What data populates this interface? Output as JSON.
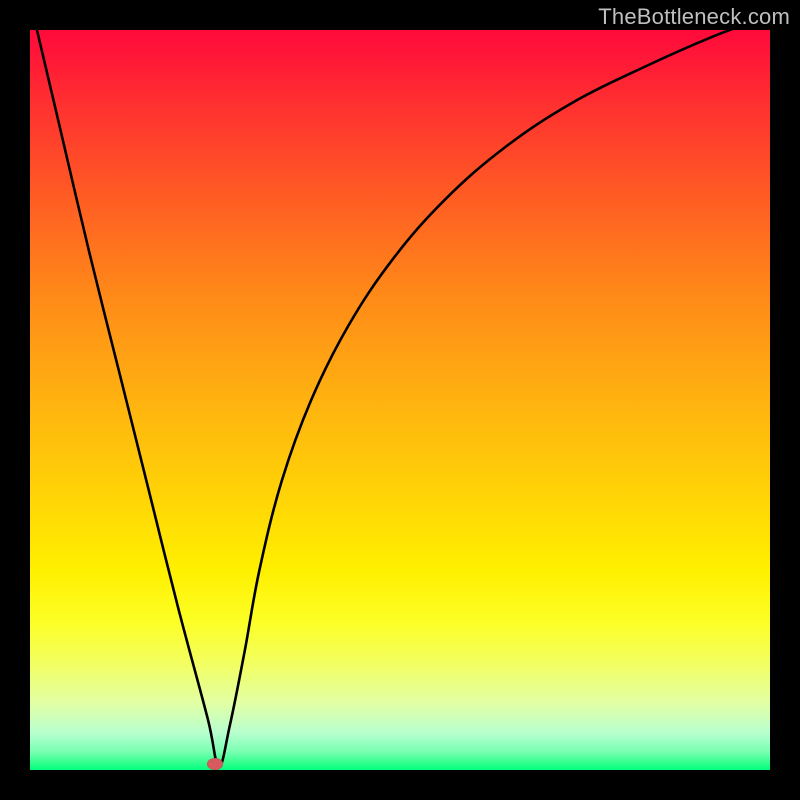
{
  "watermark": "TheBottleneck.com",
  "frame": {
    "outer_w": 800,
    "outer_h": 800,
    "border": 30
  },
  "chart_data": {
    "type": "line",
    "title": "",
    "xlabel": "",
    "ylabel": "",
    "xlim": [
      0,
      100
    ],
    "ylim": [
      0,
      100
    ],
    "grid": false,
    "legend": false,
    "series": [
      {
        "name": "bottleneck-curve",
        "x": [
          0,
          4,
          8,
          12,
          16,
          20,
          24,
          25.5,
          27,
          29,
          31,
          34,
          38,
          43,
          49,
          56,
          64,
          73,
          83,
          92,
          100
        ],
        "y": [
          104,
          87,
          70,
          54,
          38,
          22,
          7,
          0.5,
          6,
          16,
          27,
          39,
          50,
          60,
          69,
          77,
          84,
          90,
          95,
          99,
          102
        ]
      }
    ],
    "markers": [
      {
        "name": "highlight-dot",
        "x": 25.0,
        "y": 0.8,
        "color": "#d65a5e"
      }
    ],
    "gradient_stops": [
      {
        "pct": 0,
        "color": "#ff0a3a"
      },
      {
        "pct": 10,
        "color": "#ff3030"
      },
      {
        "pct": 36,
        "color": "#ff8a18"
      },
      {
        "pct": 63,
        "color": "#ffd406"
      },
      {
        "pct": 80,
        "color": "#fcff26"
      },
      {
        "pct": 95,
        "color": "#b7ffcf"
      },
      {
        "pct": 100,
        "color": "#00ff80"
      }
    ]
  }
}
